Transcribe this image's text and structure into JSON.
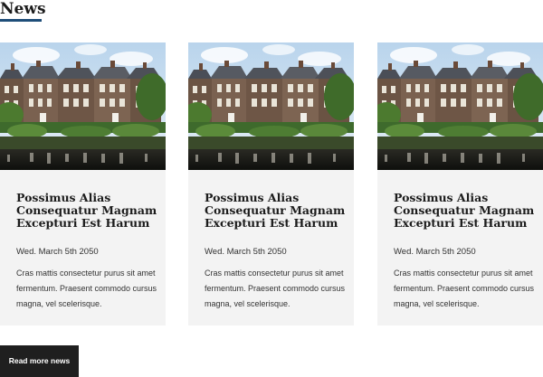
{
  "section": {
    "title": "News"
  },
  "cards": [
    {
      "image": "houses-by-water-photo",
      "title": "Possimus Alias Consequatur Magnam Excepturi Est Harum",
      "date": "Wed. March 5th 2050",
      "excerpt": "Cras mattis consectetur purus sit amet fermentum. Praesent commodo cursus magna, vel scelerisque."
    },
    {
      "image": "houses-by-water-photo",
      "title": "Possimus Alias Consequatur Magnam Excepturi Est Harum",
      "date": "Wed. March 5th 2050",
      "excerpt": "Cras mattis consectetur purus sit amet fermentum. Praesent commodo cursus magna, vel scelerisque."
    },
    {
      "image": "houses-by-water-photo",
      "title": "Possimus Alias Consequatur Magnam Excepturi Est Harum",
      "date": "Wed. March 5th 2050",
      "excerpt": "Cras mattis consectetur purus sit amet fermentum. Praesent commodo cursus magna, vel scelerisque."
    }
  ],
  "read_more_label": "Read more news",
  "colors": {
    "heading_underline": "#1f4e79",
    "card_background": "#f3f3f3",
    "button_background": "#1f1f1f",
    "button_text": "#ffffff"
  }
}
